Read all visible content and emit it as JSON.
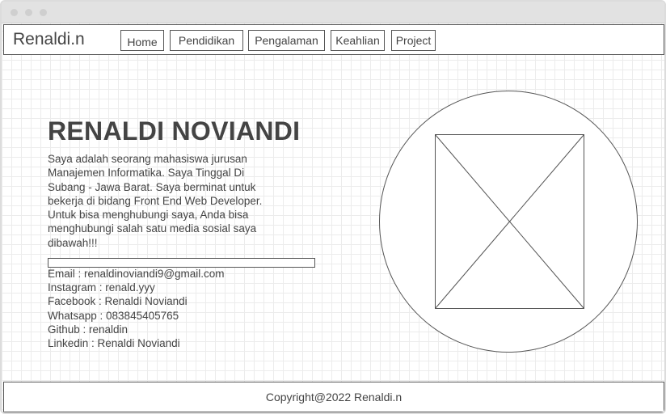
{
  "window": {
    "controls": [
      "close-dot",
      "minimize-dot",
      "maximize-dot"
    ]
  },
  "header": {
    "brand": "Renaldi.n",
    "nav": [
      "Home",
      "Pendidikan",
      "Pengalaman",
      "Keahlian",
      "Project"
    ]
  },
  "hero": {
    "name": "RENALDI NOVIANDI",
    "intro_lines": [
      "Saya adalah seorang mahasiswa jurusan",
      "Manajemen Informatika. Saya Tinggal Di",
      "Subang - Jawa Barat. Saya berminat untuk",
      "bekerja di bidang Front End Web Developer.",
      "Untuk bisa menghubungi saya, Anda bisa",
      "menghubungi salah satu media sosial saya",
      "dibawah!!!"
    ],
    "contacts": [
      "Email : renaldinoviandi9@gmail.com",
      "Instagram : renald.yyy",
      "Facebook : Renaldi Noviandi",
      "Whatsapp : 083845405765",
      "Github : renaldin",
      "Linkedin : Renaldi Noviandi"
    ]
  },
  "photo": {
    "icon": "image-placeholder-icon"
  },
  "footer": {
    "copyright": "Copyright@2022 Renaldi.n"
  },
  "colors": {
    "border": "#555555",
    "text": "#444444",
    "grid": "#ececec",
    "titlebar": "#e2e2e2"
  }
}
